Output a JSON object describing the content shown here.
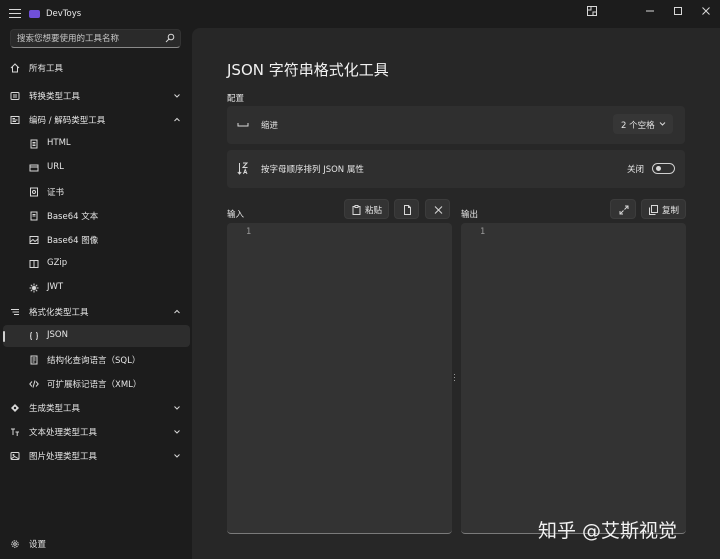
{
  "app": {
    "title": "DevToys"
  },
  "search": {
    "placeholder": "搜索您想要使用的工具名称"
  },
  "sidebar": {
    "all_tools": "所有工具",
    "groups": [
      {
        "label": "转换类型工具",
        "expanded": false
      },
      {
        "label": "编码 / 解码类型工具",
        "expanded": true,
        "items": [
          "HTML",
          "URL",
          "证书",
          "Base64 文本",
          "Base64 图像",
          "GZip",
          "JWT"
        ]
      },
      {
        "label": "格式化类型工具",
        "expanded": true,
        "items": [
          "JSON",
          "结构化查询语言（SQL）",
          "可扩展标记语言（XML）"
        ]
      },
      {
        "label": "生成类型工具",
        "expanded": false
      },
      {
        "label": "文本处理类型工具",
        "expanded": false
      },
      {
        "label": "图片处理类型工具",
        "expanded": false
      }
    ],
    "selected": "JSON",
    "settings": "设置"
  },
  "main": {
    "title": "JSON 字符串格式化工具",
    "config_label": "配置",
    "indent": {
      "label": "缩进",
      "value": "2 个空格"
    },
    "sort": {
      "label": "按字母顺序排列 JSON 属性",
      "state_label": "关闭",
      "on": false
    },
    "input": {
      "label": "输入",
      "paste_label": "粘贴",
      "line_number": "1"
    },
    "output": {
      "label": "输出",
      "copy_label": "复制",
      "line_number": "1"
    }
  },
  "watermark": "知乎 @艾斯视觉",
  "colors": {
    "background": "#1c1c1c",
    "panel": "#272727",
    "card": "#2f2f2f",
    "editor": "#333333",
    "accent": "#6f4fd8"
  }
}
